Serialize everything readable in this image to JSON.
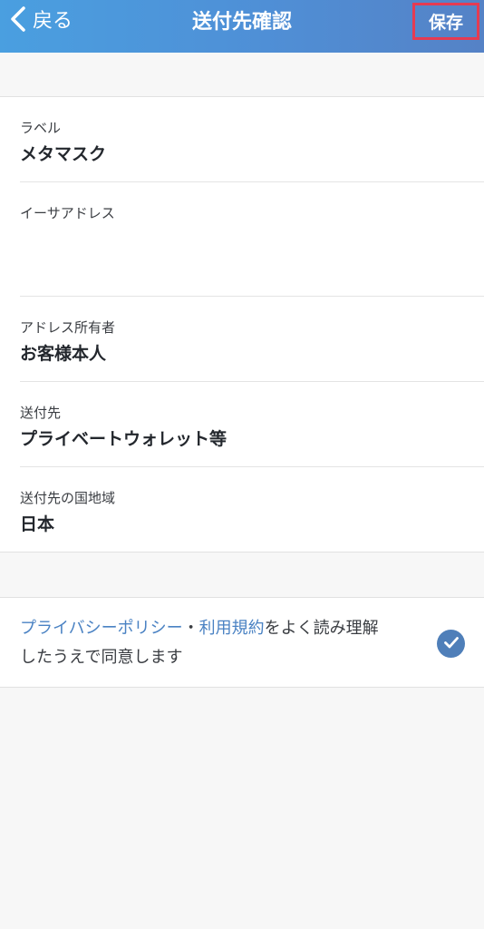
{
  "header": {
    "back_label": "戻る",
    "title": "送付先確認",
    "save_label": "保存"
  },
  "fields": [
    {
      "label": "ラベル",
      "value": "メタマスク"
    },
    {
      "label": "イーサアドレス",
      "value": ""
    },
    {
      "label": "アドレス所有者",
      "value": "お客様本人"
    },
    {
      "label": "送付先",
      "value": "プライベートウォレット等"
    },
    {
      "label": "送付先の国地域",
      "value": "日本"
    }
  ],
  "agreement": {
    "privacy_link": "プライバシーポリシー",
    "separator": "・",
    "terms_link": "利用規約",
    "text_middle": "をよく読み理解",
    "text_end": "したうえで同意します",
    "checked": true
  },
  "colors": {
    "header_start": "#4a9fe0",
    "header_end": "#5582c6",
    "link": "#4a82c3",
    "check": "#4f7fb9",
    "highlight": "#e53b52"
  },
  "icons": {
    "back": "chevron-left-icon",
    "check": "check-circle-icon"
  }
}
